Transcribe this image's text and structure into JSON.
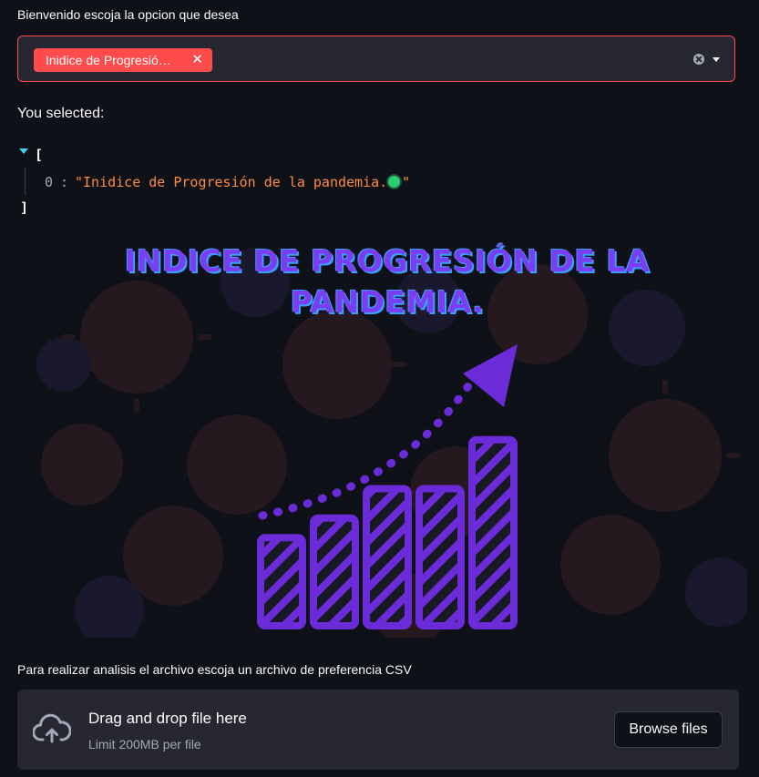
{
  "multiselect": {
    "label": "Bienvenido escoja la opcion que desea",
    "selected_chip": "Inidice de Progresión de la pandemia.",
    "chip_close": "✕",
    "clear_icon": "clear-icon",
    "dropdown_icon": "chevron-down-icon",
    "accent_color": "#ff4b4b"
  },
  "selection": {
    "label": "You selected:",
    "json_open": "[",
    "json_close": "]",
    "items": [
      {
        "index": "0",
        "value": "\"Inidice de Progresión de la pandemia.",
        "suffix": "\""
      }
    ]
  },
  "banner": {
    "title_line1": "INDICE DE PROGRESIÓN DE LA",
    "title_line2": "PANDEMIA.",
    "title_color": "#7b3df2",
    "bar_levels": [
      0.45,
      0.55,
      0.7,
      0.7,
      0.95
    ]
  },
  "uploader": {
    "label": "Para realizar analisis el archivo escoja un archivo de preferencia CSV",
    "drag_text": "Drag and drop file here",
    "limit_text": "Limit 200MB per file",
    "browse_label": "Browse files",
    "icon": "cloud-upload-icon"
  }
}
